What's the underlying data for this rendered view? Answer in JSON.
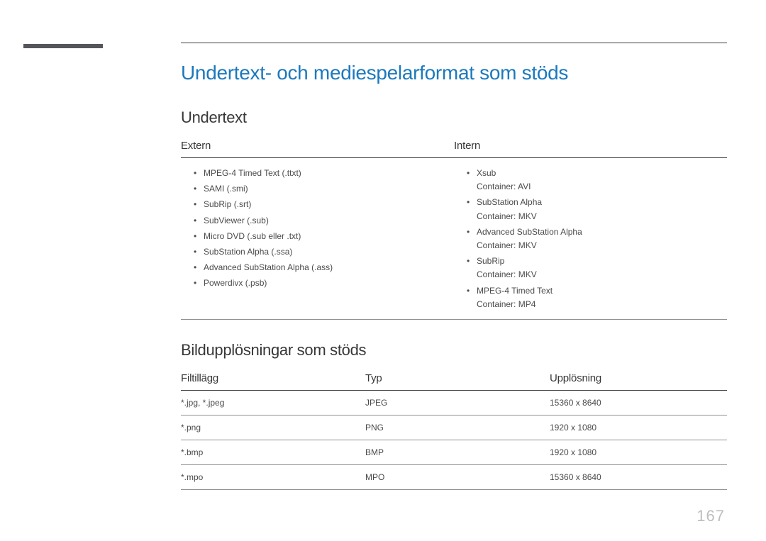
{
  "page_number": "167",
  "headings": {
    "main": "Undertext- och mediespelarformat som stöds",
    "subtitle_section": "Undertext",
    "image_section": "Bildupplösningar som stöds"
  },
  "subtitle_cols": {
    "extern": {
      "header": "Extern",
      "items": [
        {
          "text": "MPEG-4 Timed Text (.ttxt)"
        },
        {
          "text": "SAMI (.smi)"
        },
        {
          "text": "SubRip (.srt)"
        },
        {
          "text": "SubViewer (.sub)"
        },
        {
          "text": "Micro DVD (.sub eller .txt)"
        },
        {
          "text": "SubStation Alpha (.ssa)"
        },
        {
          "text": "Advanced SubStation Alpha (.ass)"
        },
        {
          "text": "Powerdivx (.psb)"
        }
      ]
    },
    "intern": {
      "header": "Intern",
      "items": [
        {
          "text": "Xsub",
          "sub": "Container: AVI"
        },
        {
          "text": "SubStation Alpha",
          "sub": "Container: MKV"
        },
        {
          "text": "Advanced SubStation Alpha",
          "sub": "Container: MKV"
        },
        {
          "text": "SubRip",
          "sub": "Container: MKV"
        },
        {
          "text": "MPEG-4 Timed Text",
          "sub": "Container: MP4"
        }
      ]
    }
  },
  "image_table": {
    "headers": {
      "ext": "Filtillägg",
      "type": "Typ",
      "res": "Upplösning"
    },
    "rows": [
      {
        "ext": "*.jpg, *.jpeg",
        "type": "JPEG",
        "res": "15360 x 8640"
      },
      {
        "ext": "*.png",
        "type": "PNG",
        "res": "1920 x 1080"
      },
      {
        "ext": "*.bmp",
        "type": "BMP",
        "res": "1920 x 1080"
      },
      {
        "ext": "*.mpo",
        "type": "MPO",
        "res": "15360 x 8640"
      }
    ]
  }
}
